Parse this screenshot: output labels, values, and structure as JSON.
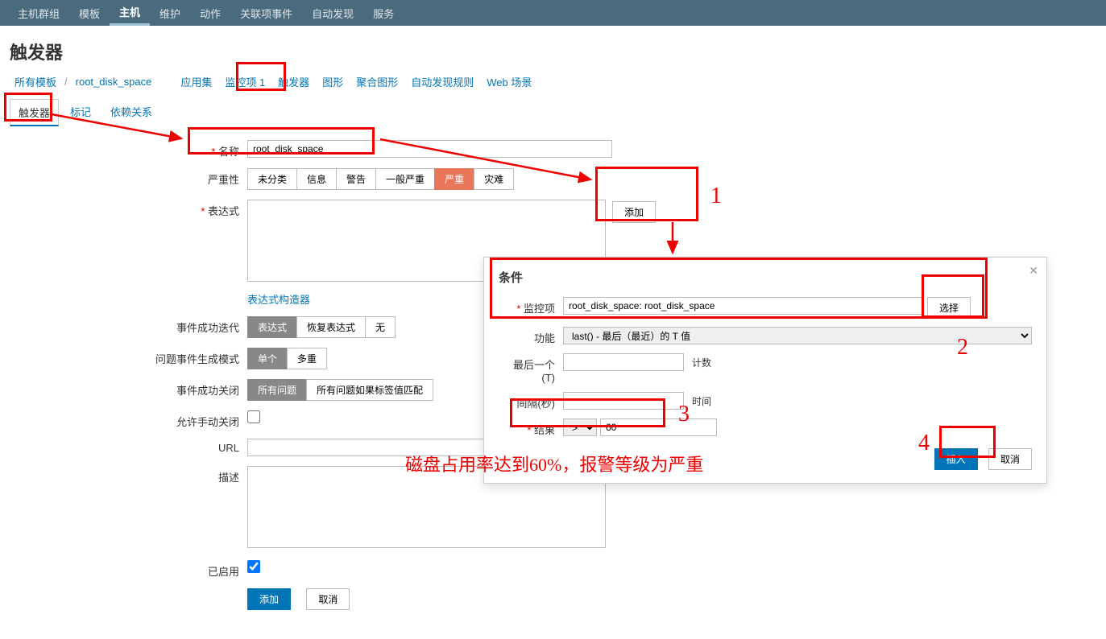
{
  "topnav": {
    "items": [
      "主机群组",
      "模板",
      "主机",
      "维护",
      "动作",
      "关联项事件",
      "自动发现",
      "服务"
    ],
    "active_index": 2
  },
  "page_title": "触发器",
  "breadcrumb": {
    "all_templates": "所有模板",
    "template_name": "root_disk_space",
    "items": [
      "应用集",
      "监控项 1",
      "触发器",
      "图形",
      "聚合图形",
      "自动发现规则",
      "Web 场景"
    ]
  },
  "subtabs": {
    "items": [
      "触发器",
      "标记",
      "依赖关系"
    ],
    "active_index": 0
  },
  "form": {
    "name_label": "名称",
    "name_value": "root_disk_space",
    "severity_label": "严重性",
    "severity_options": [
      "未分类",
      "信息",
      "警告",
      "一般严重",
      "严重",
      "灾难"
    ],
    "expression_label": "表达式",
    "expression_add": "添加",
    "expression_constructor": "表达式构造器",
    "ok_event_label": "事件成功迭代",
    "ok_event_options": [
      "表达式",
      "恢复表达式",
      "无"
    ],
    "problem_mode_label": "问题事件生成模式",
    "problem_mode_options": [
      "单个",
      "多重"
    ],
    "ok_close_label": "事件成功关闭",
    "ok_close_options": [
      "所有问题",
      "所有问题如果标签值匹配"
    ],
    "manual_close_label": "允许手动关闭",
    "url_label": "URL",
    "desc_label": "描述",
    "enabled_label": "已启用",
    "submit_add": "添加",
    "submit_cancel": "取消"
  },
  "modal": {
    "title": "条件",
    "item_label": "监控项",
    "item_value": "root_disk_space: root_disk_space",
    "select_button": "选择",
    "function_label": "功能",
    "function_value": "last() - 最后（最近）的 T 值",
    "last_label": "最后一个 (T)",
    "last_unit": "计数",
    "interval_label": "间隔(秒)",
    "interval_unit": "时间",
    "result_label": "结果",
    "result_op": ">=",
    "result_value": "60",
    "insert": "插入",
    "cancel": "取消"
  },
  "annotations": {
    "n1": "1",
    "n2": "2",
    "n3": "3",
    "n4": "4",
    "text": "磁盘占用率达到60%，报警等级为严重"
  }
}
